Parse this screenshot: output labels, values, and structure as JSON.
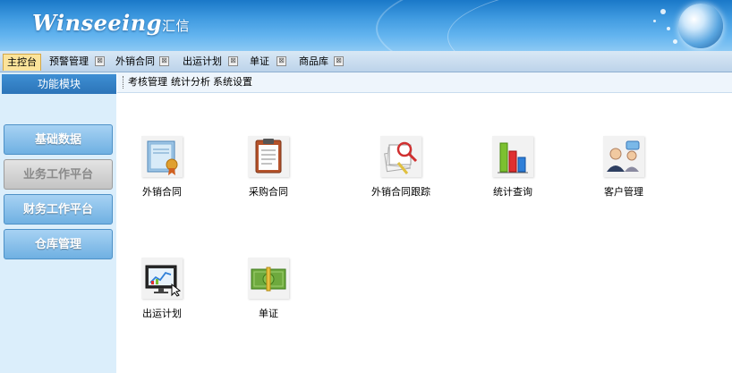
{
  "header": {
    "logo_text": "Winseeing",
    "logo_cn": "汇信"
  },
  "tabs": [
    {
      "label": "主控台",
      "active": true
    },
    {
      "label": "预警管理",
      "closable": true
    },
    {
      "label": "外销合同",
      "closable": true
    },
    {
      "label": "出运计划",
      "closable": true
    },
    {
      "label": "单证",
      "closable": true
    },
    {
      "label": "商品库",
      "closable": true
    }
  ],
  "tab_close_glyph": "⊠",
  "sidebar": {
    "title": "功能模块",
    "modules": [
      {
        "label": "基础数据",
        "selected": false
      },
      {
        "label": "业务工作平台",
        "selected": true
      },
      {
        "label": "财务工作平台",
        "selected": false
      },
      {
        "label": "仓库管理",
        "selected": false
      }
    ]
  },
  "submenu": {
    "items": [
      "考核管理",
      "统计分析",
      "系统设置"
    ]
  },
  "apps": [
    {
      "label": "外销合同",
      "icon": "certificate-icon"
    },
    {
      "label": "采购合同",
      "icon": "clipboard-icon"
    },
    {
      "label": "外销合同跟踪",
      "icon": "document-search-icon"
    },
    {
      "label": "统计查询",
      "icon": "bar-chart-icon"
    },
    {
      "label": "客户管理",
      "icon": "customer-icon"
    },
    {
      "label": "出运计划",
      "icon": "monitor-chart-icon"
    },
    {
      "label": "单证",
      "icon": "banknote-icon"
    }
  ],
  "colors": {
    "accent": "#2c74b8",
    "active_tab": "#fbe39a",
    "sidebar_bg": "#dbeefb"
  }
}
